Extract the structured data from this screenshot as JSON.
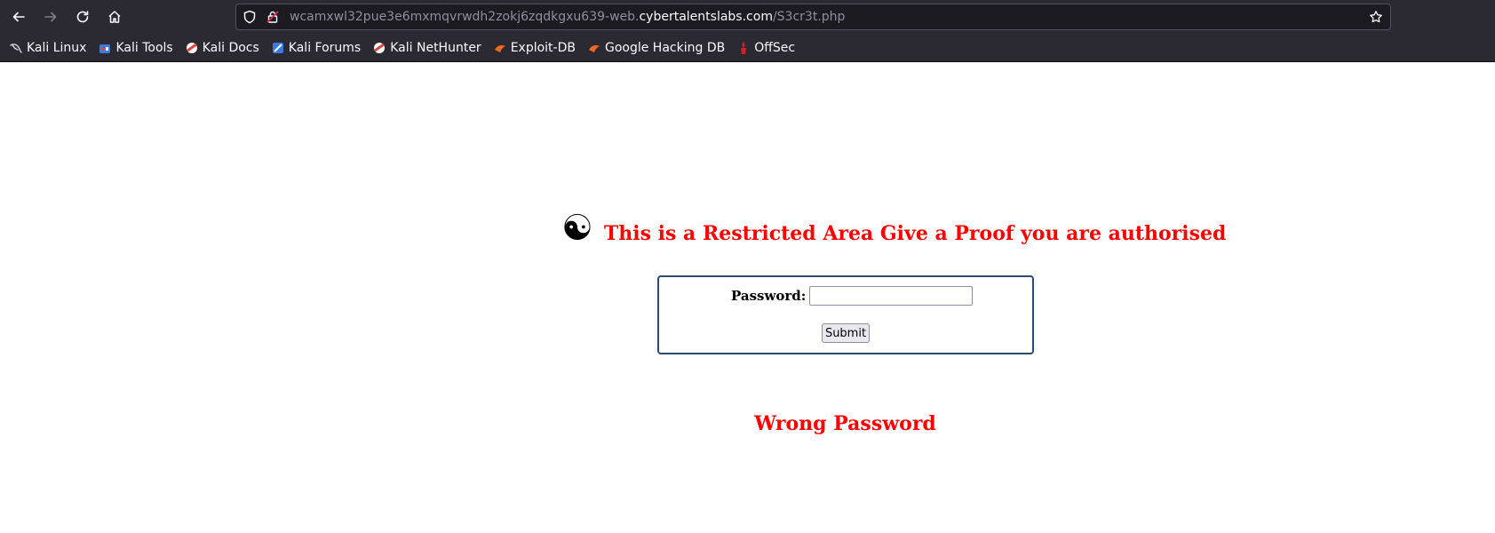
{
  "browser": {
    "url_prefix": "wcamxwl32pue3e6mxmqvrwdh2zokj6zqdkgxu639-web.",
    "url_domain": "cybertalentslabs.com",
    "url_path": "/S3cr3t.php"
  },
  "bookmarks": [
    {
      "label": "Kali Linux",
      "icon": "kali-dragon-icon"
    },
    {
      "label": "Kali Tools",
      "icon": "kali-tools-icon"
    },
    {
      "label": "Kali Docs",
      "icon": "kali-docs-icon"
    },
    {
      "label": "Kali Forums",
      "icon": "kali-forums-icon"
    },
    {
      "label": "Kali NetHunter",
      "icon": "kali-nethunter-icon"
    },
    {
      "label": "Exploit-DB",
      "icon": "exploit-db-icon"
    },
    {
      "label": "Google Hacking DB",
      "icon": "ghdb-icon"
    },
    {
      "label": "OffSec",
      "icon": "offsec-icon"
    }
  ],
  "page": {
    "symbol": "☯",
    "heading": "This is a Restricted Area Give a Proof you are authorised",
    "password_label": "Password:",
    "password_value": "",
    "submit_label": "Submit",
    "message": "Wrong Password"
  },
  "colors": {
    "heading": "#ff0000",
    "chrome_bg": "#2b2a33",
    "urlbar_bg": "#1c1b22",
    "form_border": "#2b4a6f"
  }
}
